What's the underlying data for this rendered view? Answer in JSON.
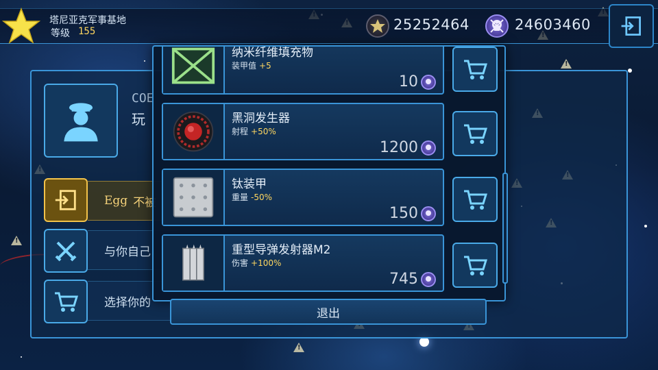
{
  "top_bar": {
    "base_name": "塔尼亚克军事基地",
    "level_label": "等级",
    "level_value": "155",
    "gold_amount": "25252464",
    "skull_amount": "24603460"
  },
  "profile": {
    "player_code": "COE",
    "player_name": "玩",
    "menu": [
      {
        "prefix": "Egg",
        "label": "不被",
        "icon": "enter-icon"
      },
      {
        "label": "与你自己",
        "icon": "crossed-swords-icon"
      },
      {
        "label": "选择你的",
        "icon": "cart-icon"
      }
    ]
  },
  "shop": {
    "items": [
      {
        "name": "纳米纤维填充物",
        "stat_label": "装甲值",
        "stat_value": "+5",
        "price": "10",
        "icon": "nano-fiber-icon"
      },
      {
        "name": "黑洞发生器",
        "stat_label": "射程",
        "stat_value": "+50%",
        "price": "1200",
        "icon": "black-hole-generator-icon"
      },
      {
        "name": "钛装甲",
        "stat_label": "重量",
        "stat_value": "-50%",
        "price": "150",
        "icon": "titanium-armor-icon"
      },
      {
        "name": "重型导弹发射器M2",
        "stat_label": "伤害",
        "stat_value": "+100%",
        "price": "745",
        "icon": "missile-launcher-icon"
      }
    ],
    "exit_label": "退出"
  },
  "colors": {
    "accent": "#3a95d8",
    "gold": "#ffd760",
    "panel": "#12385e"
  }
}
